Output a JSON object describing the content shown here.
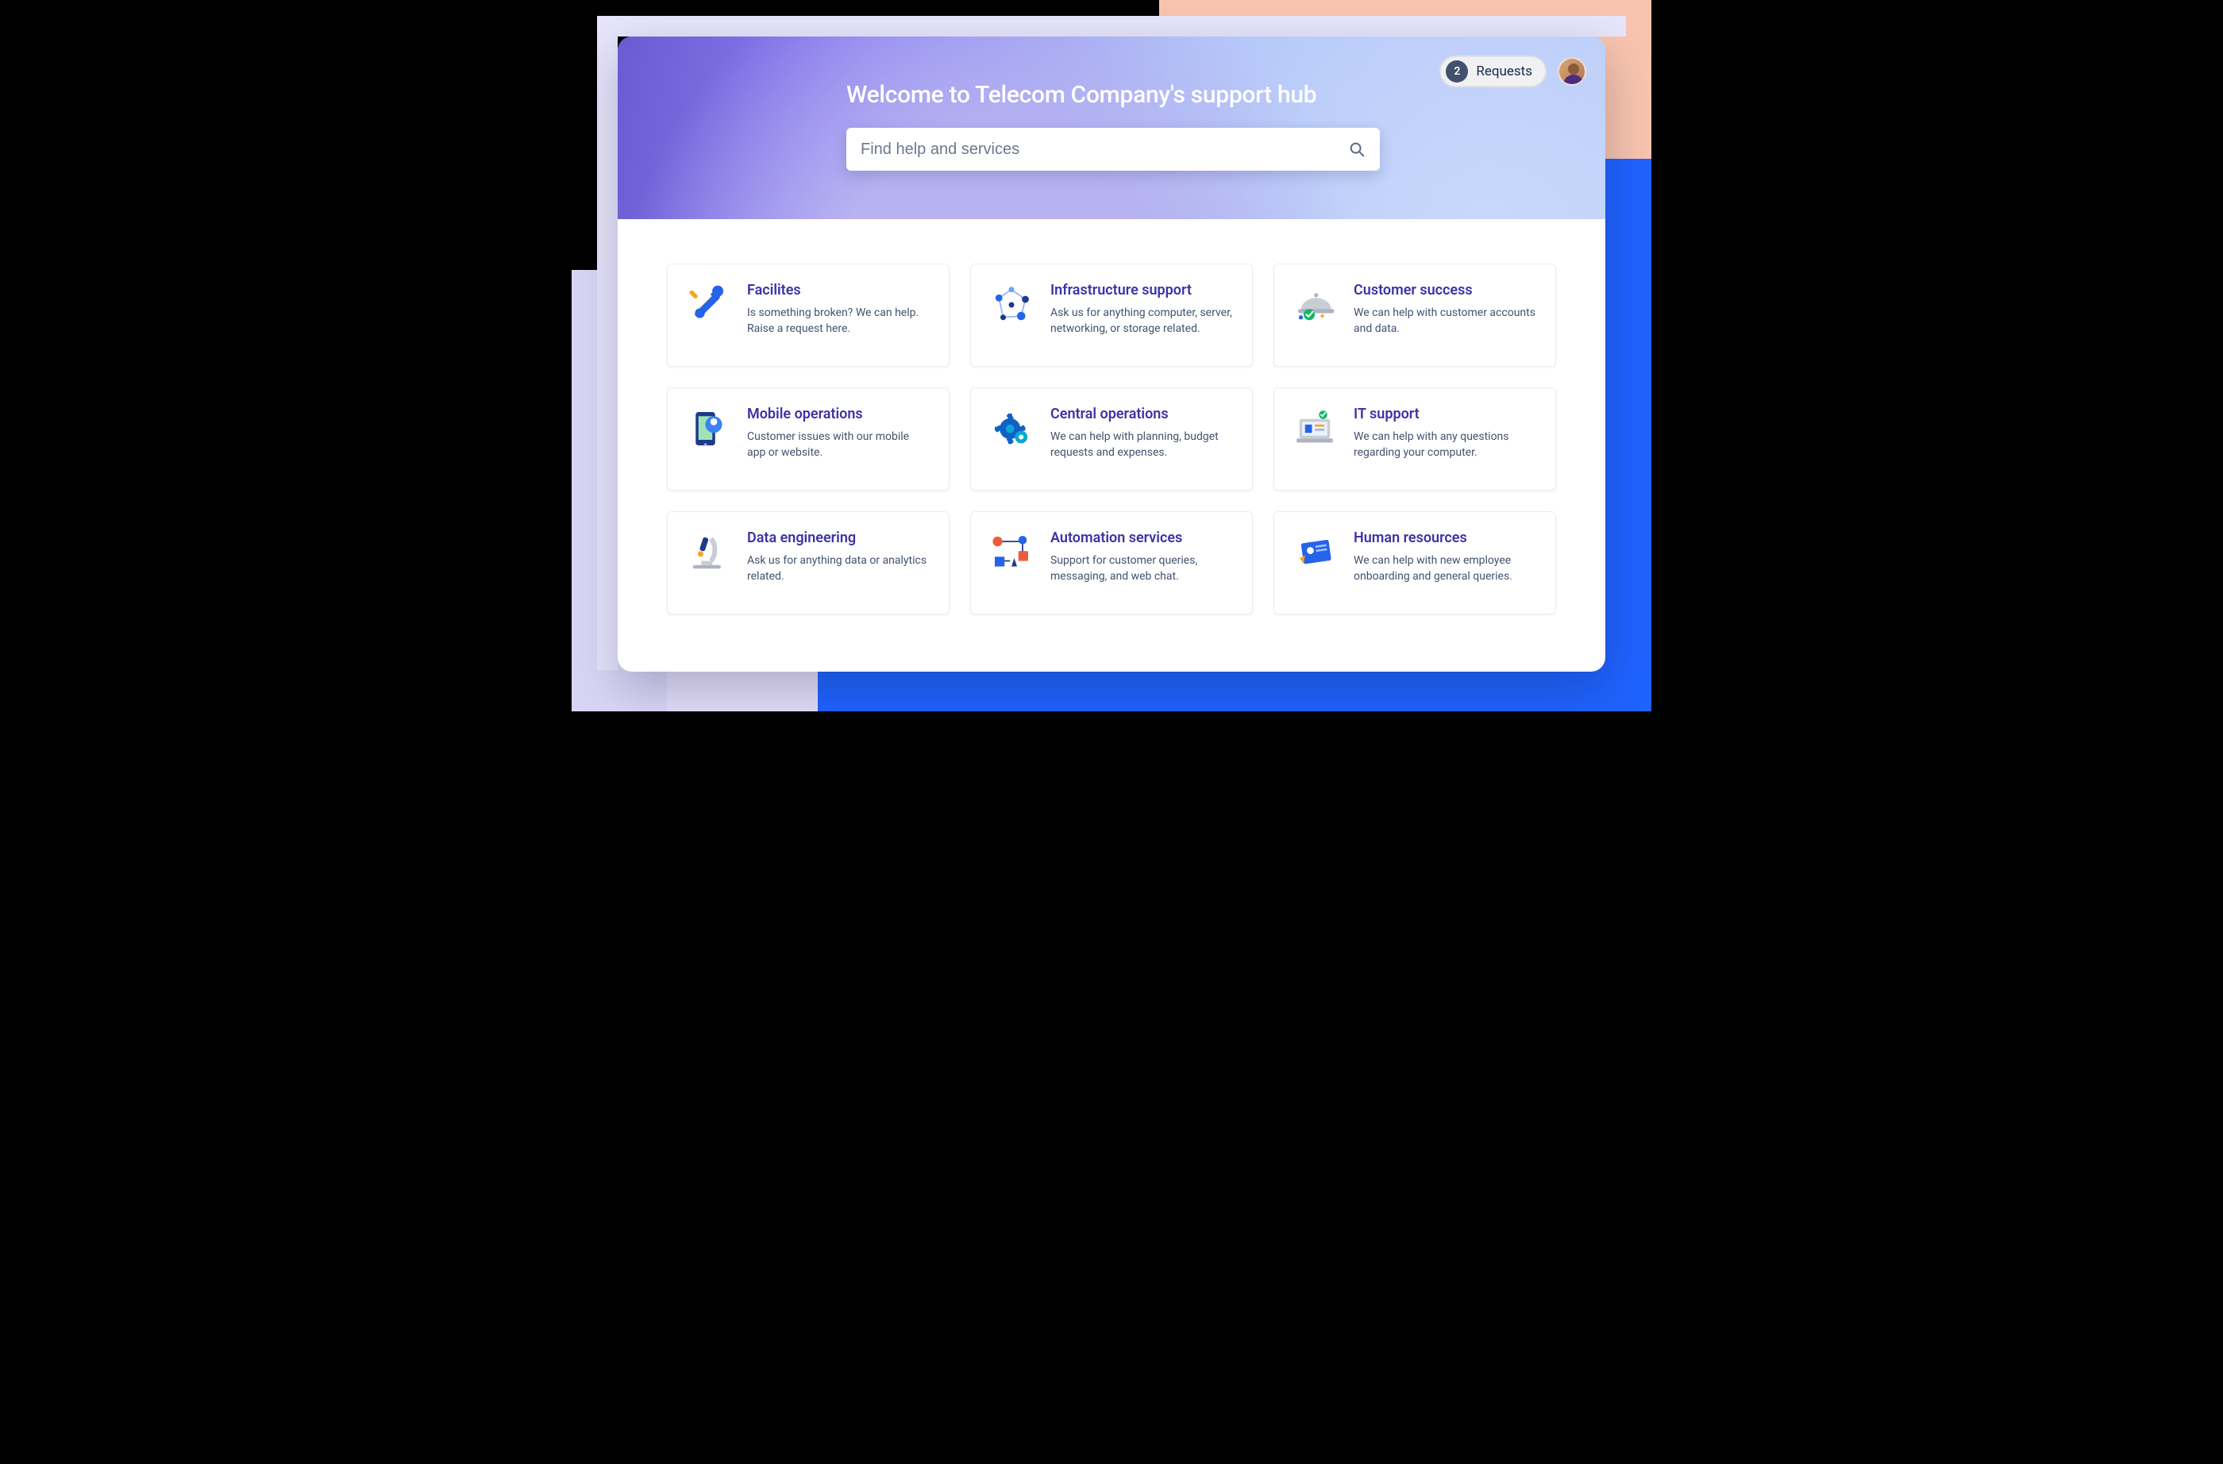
{
  "hero": {
    "title": "Welcome to Telecom Company's support hub",
    "search_placeholder": "Find help and services"
  },
  "topbar": {
    "requests_count": "2",
    "requests_label": "Requests"
  },
  "cards": [
    {
      "icon": "tools",
      "title": "Facilites",
      "desc": "Is something broken? We can help. Raise a request here."
    },
    {
      "icon": "network",
      "title": "Infrastructure support",
      "desc": "Ask us for anything computer, server, networking, or storage related."
    },
    {
      "icon": "cloche",
      "title": "Customer success",
      "desc": "We can help with customer accounts and data."
    },
    {
      "icon": "phone-pin",
      "title": "Mobile operations",
      "desc": "Customer issues with our mobile app or website."
    },
    {
      "icon": "gear",
      "title": "Central operations",
      "desc": "We can help with planning, budget requests and expenses."
    },
    {
      "icon": "laptop",
      "title": "IT support",
      "desc": "We can help with any questions regarding your computer."
    },
    {
      "icon": "microscope",
      "title": "Data engineering",
      "desc": "Ask us for anything data or analytics related."
    },
    {
      "icon": "shapes",
      "title": "Automation services",
      "desc": "Support for customer queries, messaging, and web chat."
    },
    {
      "icon": "id-card",
      "title": "Human resources",
      "desc": "We can help with new employee onboarding and general queries."
    }
  ]
}
